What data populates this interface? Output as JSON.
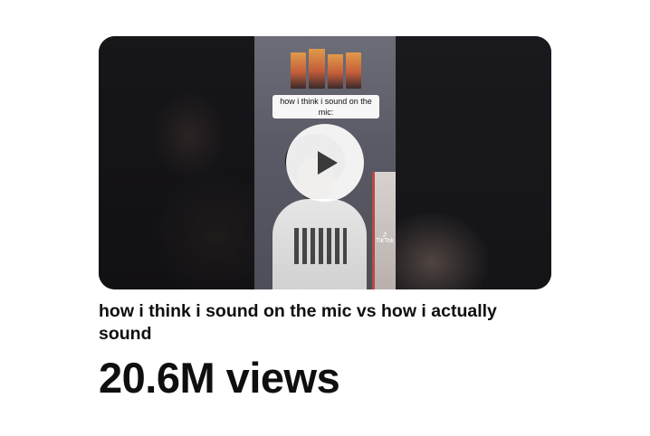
{
  "video": {
    "overlay_caption": "how i think i sound on the mic:",
    "watermark": "TikTok",
    "play_icon": "play-icon",
    "title": "how i think i sound on the mic vs how i actually sound",
    "views": "20.6M views"
  },
  "colors": {
    "text": "#0f0f0f",
    "background": "#ffffff",
    "play_button_bg": "#ffffff"
  }
}
